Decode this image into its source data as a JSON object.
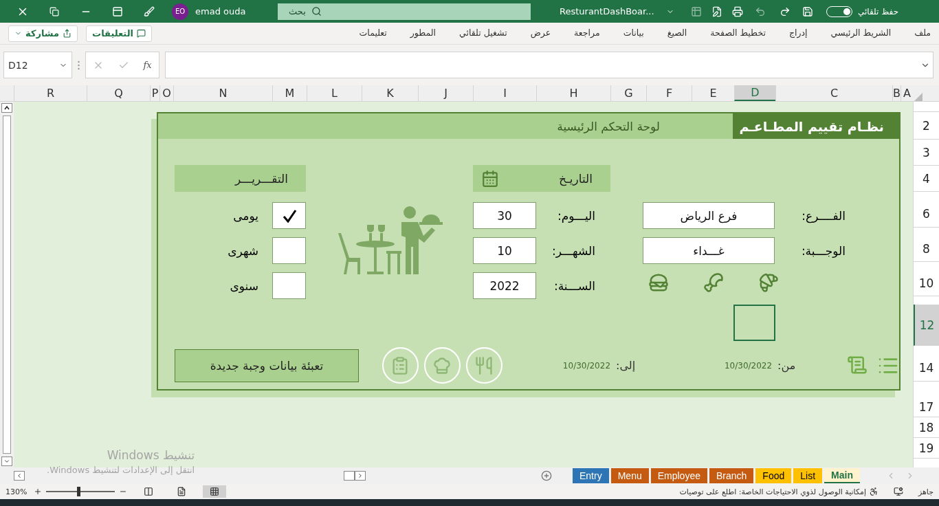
{
  "title_bar": {
    "autosave_label": "حفظ تلقائي",
    "autosave_on": true,
    "file_name": "ResturantDashBoar...",
    "search_placeholder": "بحث",
    "user_initials": "EO",
    "user_name": "emad ouda"
  },
  "ribbon": {
    "tabs": [
      {
        "label": "ملف",
        "selected": false
      },
      {
        "label": "الشريط الرئيسي",
        "selected": false
      },
      {
        "label": "إدراج",
        "selected": false
      },
      {
        "label": "تخطيط الصفحة",
        "selected": false
      },
      {
        "label": "الصيغ",
        "selected": false
      },
      {
        "label": "بيانات",
        "selected": false
      },
      {
        "label": "مراجعة",
        "selected": false
      },
      {
        "label": "عرض",
        "selected": false
      },
      {
        "label": "تشغيل تلقائي",
        "selected": false
      },
      {
        "label": "المطور",
        "selected": false
      },
      {
        "label": "تعليمات",
        "selected": false
      }
    ],
    "comments_button": "التعليقات",
    "share_button": "مشاركة"
  },
  "formula_bar": {
    "name_box": "D12",
    "function_label": "fx"
  },
  "columns": [
    {
      "label": "A",
      "selected": false
    },
    {
      "label": "B",
      "selected": false
    },
    {
      "label": "C",
      "selected": false
    },
    {
      "label": "D",
      "selected": true
    },
    {
      "label": "E",
      "selected": false
    },
    {
      "label": "F",
      "selected": false
    },
    {
      "label": "G",
      "selected": false
    },
    {
      "label": "H",
      "selected": false
    },
    {
      "label": "I",
      "selected": false
    },
    {
      "label": "J",
      "selected": false
    },
    {
      "label": "K",
      "selected": false
    },
    {
      "label": "L",
      "selected": false
    },
    {
      "label": "M",
      "selected": false
    },
    {
      "label": "N",
      "selected": false
    },
    {
      "label": "O",
      "selected": false
    },
    {
      "label": "P",
      "selected": false
    },
    {
      "label": "Q",
      "selected": false
    },
    {
      "label": "R",
      "selected": false
    }
  ],
  "rows": [
    {
      "label": "2",
      "selected": false
    },
    {
      "label": "3",
      "selected": false
    },
    {
      "label": "4",
      "selected": false
    },
    {
      "label": "6",
      "selected": false
    },
    {
      "label": "8",
      "selected": false
    },
    {
      "label": "10",
      "selected": false
    },
    {
      "label": "12",
      "selected": true
    },
    {
      "label": "14",
      "selected": false
    },
    {
      "label": "17",
      "selected": false
    },
    {
      "label": "18",
      "selected": false
    },
    {
      "label": "19",
      "selected": false
    }
  ],
  "dashboard": {
    "title": "نظـام تقييم المطـاعـم",
    "subtitle": "لوحة التحكم الرئيسية",
    "report": {
      "header": "التقـــريـــر",
      "options": [
        {
          "label": "يومى",
          "checked": true
        },
        {
          "label": "شهرى",
          "checked": false
        },
        {
          "label": "سنوى",
          "checked": false
        }
      ]
    },
    "date": {
      "header": "التاريـخ",
      "fields": [
        {
          "label": "اليـــوم:",
          "value": "30"
        },
        {
          "label": "الشهـــر:",
          "value": "10"
        },
        {
          "label": "الســـنة:",
          "value": "2022"
        }
      ]
    },
    "branch": {
      "fields": [
        {
          "label": "الفــــرع:",
          "value": "فرع الرياض"
        },
        {
          "label": "الوجـــبة:",
          "value": "غـــداء"
        }
      ]
    },
    "range": {
      "from_label": "من:",
      "from": "10/30/2022",
      "to_label": "إلى:",
      "to": "10/30/2022"
    },
    "new_meal_button": "تعبئة بيانات وجبة جديدة"
  },
  "windows_activation": {
    "title": "تنشيط Windows",
    "message": "انتقل إلى الإعدادات لتنشيط Windows."
  },
  "sheet_tabs": [
    {
      "label": "Main",
      "color": "#fff2cc",
      "selected": true
    },
    {
      "label": "List",
      "color": "#ffc000",
      "selected": false
    },
    {
      "label": "Food",
      "color": "#ffc000",
      "selected": false
    },
    {
      "label": "Branch",
      "color": "#c55a11",
      "selected": false
    },
    {
      "label": "Employee",
      "color": "#c55a11",
      "selected": false
    },
    {
      "label": "Menu",
      "color": "#c55a11",
      "selected": false
    },
    {
      "label": "Entry",
      "color": "#2e75b6",
      "selected": false
    }
  ],
  "status_bar": {
    "ready": "جاهز",
    "accessibility": "إمكانية الوصول لذوي الاحتياجات الخاصة: اطلع على توصيات",
    "zoom": "130%",
    "zoom_slider": {
      "level": 0.47
    }
  }
}
